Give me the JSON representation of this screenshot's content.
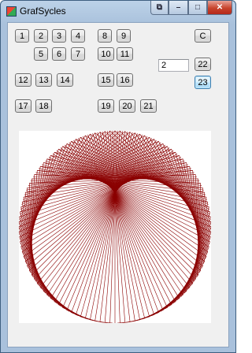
{
  "window": {
    "title": "GrafSycles"
  },
  "controls": {
    "restore": "⧉",
    "minimize": "–",
    "maximize": "□",
    "close": "✕"
  },
  "buttons": [
    "1",
    "2",
    "3",
    "4",
    "5",
    "6",
    "7",
    "8",
    "9",
    "10",
    "11",
    "12",
    "13",
    "14",
    "15",
    "16",
    "17",
    "18",
    "19",
    "20",
    "21",
    "22",
    "23",
    "C"
  ],
  "input": {
    "value": "2"
  },
  "drawing": {
    "line_color": "#8b0000",
    "background": "#ffffff"
  }
}
